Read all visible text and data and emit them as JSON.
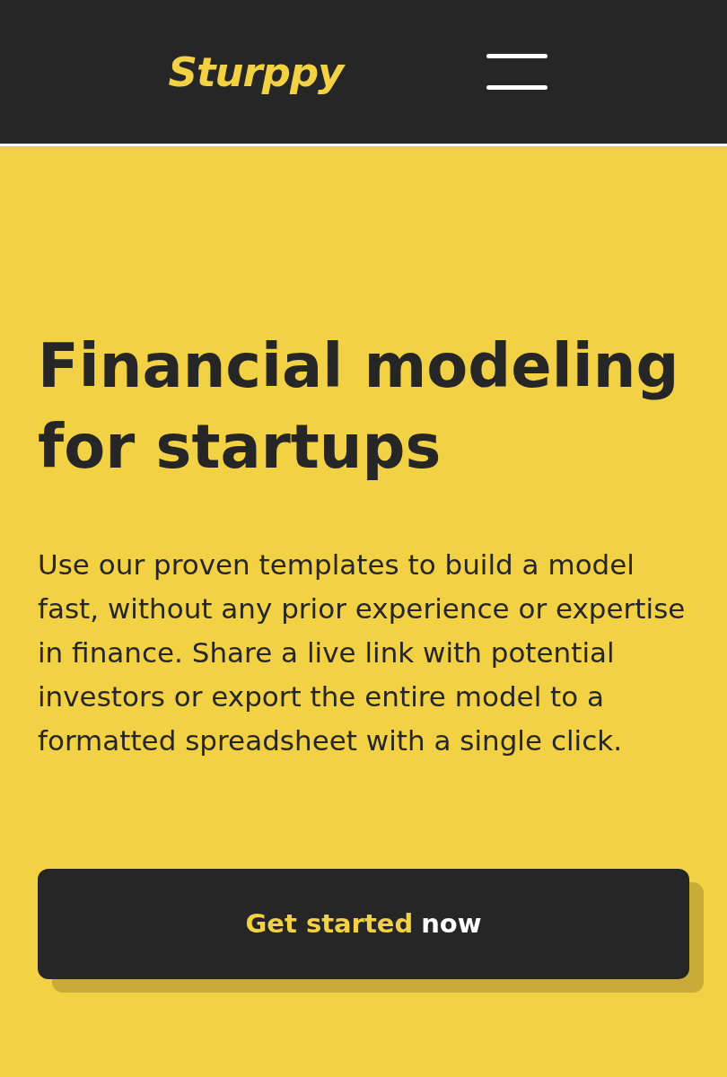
{
  "header": {
    "logo": "Sturppy"
  },
  "hero": {
    "title": "Financial modeling for startups",
    "description": "Use our proven templates to build a model fast, without any prior experience or expertise in finance. Share a live link with potential investors or export the entire model to a formatted spreadsheet with a single click.",
    "cta": {
      "highlight": "Get started",
      "rest": "now"
    }
  }
}
